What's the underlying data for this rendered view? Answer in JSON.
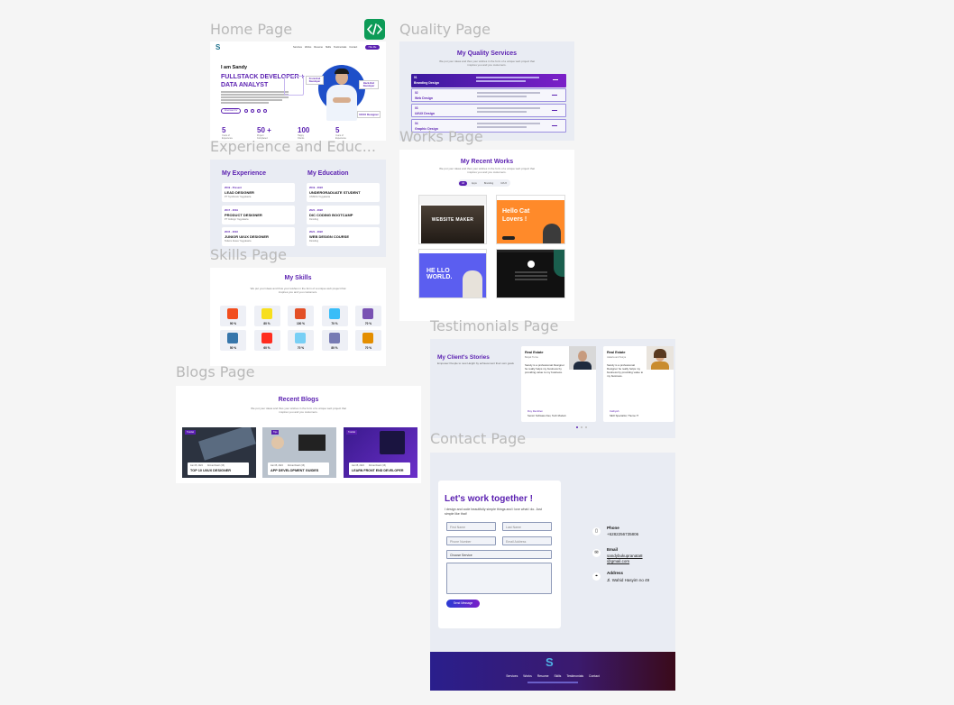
{
  "frames": {
    "home": "Home Page",
    "quality": "Quality Page",
    "experience": "Experience and Educ...",
    "works": "Works Page",
    "skills": "Skills Page",
    "testimonials": "Testimonials Page",
    "blogs": "Blogs Page",
    "contact": "Contact Page"
  },
  "home": {
    "logo": "S",
    "nav": [
      "Services",
      "Works",
      "Resume",
      "Skills",
      "Testimonials",
      "Contact"
    ],
    "hire_btn": "Hire Me",
    "greeting": "I am Sandy",
    "headline_1": "FULLSTACK DEVELOPER +",
    "headline_2": "DATA ANALYST",
    "download_btn": "Download CV",
    "badge_frontend": "Front-End Developer",
    "badge_backend": "Back-End Developer",
    "badge_uiux": "UI/UX Designer",
    "stats": [
      {
        "value": "5",
        "label": "Years of Experience"
      },
      {
        "value": "50 +",
        "label": "Project Completed"
      },
      {
        "value": "100",
        "label": "Happy Clients"
      },
      {
        "value": "5",
        "label": "Years of Experience"
      }
    ]
  },
  "quality": {
    "title": "My Quality Services",
    "subtitle_1": "We put your ideas and thus your wishes in the form of a unique web project that",
    "subtitle_2": "inspires you and you customers.",
    "services": [
      {
        "num": "01",
        "name": "Branding Design"
      },
      {
        "num": "02",
        "name": "Web Design"
      },
      {
        "num": "03",
        "name": "UI/UX Design"
      },
      {
        "num": "04",
        "name": "Graphic Design"
      }
    ]
  },
  "experience": {
    "exp_title": "My Experience",
    "edu_title": "My Education",
    "exp_items": [
      {
        "years": "2019 - Present",
        "title": "LEAD DESIGNER",
        "sub": "PT Symbiosis Yogyakarta"
      },
      {
        "years": "2017 - 2019",
        "title": "PRODUCT DESIGNER",
        "sub": "PT Indisign Yogyakarta"
      },
      {
        "years": "2015 - 2016",
        "title": "JUNIOR UI/UX DESIGNER",
        "sub": "Telkom Akses Yogyakarta"
      }
    ],
    "edu_items": [
      {
        "years": "2019 - 2023",
        "title": "UNDERGRADUATE STUDENT",
        "sub": "UNSIKA Yogyakarta"
      },
      {
        "years": "2021 - 2022",
        "title": "DIC CODING BOOTCAMP",
        "sub": "Dicoding"
      },
      {
        "years": "2021 - 2022",
        "title": "WEB DESIGN COURSE",
        "sub": "Dicoding"
      }
    ]
  },
  "works": {
    "title": "My Recent Works",
    "subtitle_1": "We put your ideas and thus your wishes in the form of a unique web project that",
    "subtitle_2": "inspires you and you customers.",
    "filters": [
      "All",
      "Apps",
      "Branding",
      "UI/UX"
    ],
    "thumb_1": "WEBSITE MAKER",
    "thumb_2_line1": "Hello Cat",
    "thumb_2_line2": "Lovers !",
    "thumb_3": "HE LLO WORLD."
  },
  "skills": {
    "title": "My Skills",
    "subtitle_1": "We put your ideas and thus your wishes in the form of a unique web project that",
    "subtitle_2": "inspires you and you customers.",
    "items": [
      {
        "icon": "figma-icon",
        "pct": "90 %",
        "color": "#f24e1e"
      },
      {
        "icon": "js-icon",
        "pct": "80 %",
        "color": "#f7df1e"
      },
      {
        "icon": "html5-icon",
        "pct": "100 %",
        "color": "#e34f26"
      },
      {
        "icon": "tailwind-icon",
        "pct": "70 %",
        "color": "#38bdf8"
      },
      {
        "icon": "bootstrap-icon",
        "pct": "70 %",
        "color": "#7952b3"
      },
      {
        "icon": "python-icon",
        "pct": "50 %",
        "color": "#3776ab"
      },
      {
        "icon": "laravel-icon",
        "pct": "60 %",
        "color": "#ff2d20"
      },
      {
        "icon": "jquery-icon",
        "pct": "70 %",
        "color": "#78cff5"
      },
      {
        "icon": "php-icon",
        "pct": "80 %",
        "color": "#777bb4"
      },
      {
        "icon": "mysql-icon",
        "pct": "70 %",
        "color": "#e48e00"
      }
    ]
  },
  "testimonials": {
    "title": "My Client's Stories",
    "subtitle": "Empower People to new Height by achievement their own goals",
    "cards": [
      {
        "label": "Real Estate",
        "sub": "Berjek Turna",
        "quote": "Sandy is a professional Designer he really helps my business by providing value to my business.",
        "name": "Roy Remblen",
        "role": "Senior Software Dev, Tech Modern"
      },
      {
        "label": "Real Estate",
        "sub": "Jakarta and Surya",
        "quote": "Sandy is a professional Designer he really helps my business by providing value to my business.",
        "name": "Cathyah",
        "role": "SEO Specialist, Theme IT"
      }
    ]
  },
  "blogs": {
    "title": "Recent Blogs",
    "subtitle_1": "We put your ideas and thus your wishes in the form of a unique web project that",
    "subtitle_2": "inspires you and you customers.",
    "posts": [
      {
        "tag": "Tutorial",
        "date": "Jan 05, 2024",
        "author": "Ahmad Fauzi (15)",
        "title": "TOP 10 UI/UX DESIGNER"
      },
      {
        "tag": "Tips",
        "date": "Jan 05, 2024",
        "author": "Ahmad Fauzi (15)",
        "title": "APP DEVELOPMENT GUIDES"
      },
      {
        "tag": "Tutorial",
        "date": "Jan 05, 2024",
        "author": "Ahmad Fauzi (15)",
        "title": "LEARN FRONT END DEVELOPER"
      }
    ]
  },
  "contact": {
    "title": "Let's work together !",
    "desc": "I design and code beautifully simple things and i love what i do. Just simple like that!",
    "first_name": "First Name",
    "last_name": "Last Name",
    "phone_ph": "Phone Number",
    "email_ph": "Email Address",
    "service_select": "Choose Service",
    "send_btn": "Send Message",
    "phone_label": "Phone",
    "phone_value": "+6282256735806",
    "email_label": "Email",
    "email_value_1": "sandybukupranata8",
    "email_value_2": "@gmail.com",
    "address_label": "Address",
    "address_value": "Jl. Wahid Hasyim no 49"
  },
  "footer": {
    "logo": "S",
    "nav": [
      "Services",
      "Works",
      "Resume",
      "Skills",
      "Testimonials",
      "Contact"
    ]
  },
  "colors": {
    "primary": "#5a1fb0",
    "accent": "#0d9b57",
    "frame_bg": "#e9ecf3",
    "footer_start": "#2a1e8c",
    "footer_end": "#3a0a1a"
  },
  "toolbar_icon": "code-icon"
}
